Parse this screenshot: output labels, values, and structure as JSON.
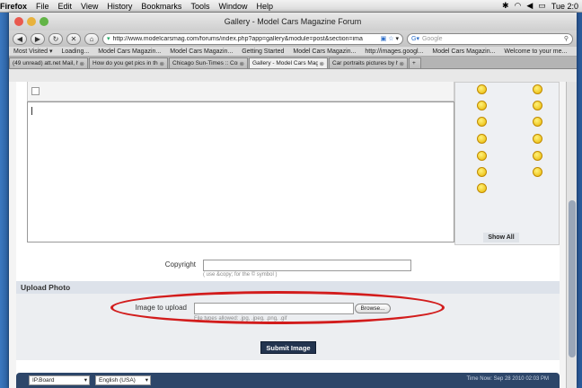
{
  "menubar": {
    "app": "Firefox",
    "items": [
      "File",
      "Edit",
      "View",
      "History",
      "Bookmarks",
      "Tools",
      "Window",
      "Help"
    ],
    "clock": "Tue 2:0"
  },
  "window": {
    "title": "Gallery - Model Cars Magazine Forum",
    "url": "http://www.modelcarsmag.com/forums/index.php?app=gallery&module=post&section=ima",
    "search_placeholder": "Google"
  },
  "bookmarks": [
    "Most Visited ▾",
    "Loading...",
    "Model Cars Magazin...",
    "Model Cars Magazin...",
    "Getting Started",
    "Model Cars Magazin...",
    "http://images.googl...",
    "Model Cars Magazin...",
    "Welcome to your me..."
  ],
  "tabs": [
    {
      "label": "(49 unread) att.net Mail, harr...",
      "active": false
    },
    {
      "label": "How do you get pics in the g...",
      "active": false
    },
    {
      "label": "Chicago Sun-Times :: Comme...",
      "active": false
    },
    {
      "label": "Gallery - Model Cars Magazi...",
      "active": true
    },
    {
      "label": "Car portraits pictures by harr...",
      "active": false
    }
  ],
  "editor": {
    "show_all": "Show All"
  },
  "form": {
    "copyright_label": "Copyright",
    "copyright_value": "",
    "copyright_hint": "( use &copy; for the © symbol )",
    "section_title": "Upload Photo",
    "image_label": "Image to upload",
    "image_value": "",
    "browse_label": "Browse...",
    "filetypes_hint": "File types allowed: .jpg, .jpeg, .png, .gif",
    "submit_label": "Submit Image"
  },
  "footer": {
    "skin_select": "IP.Board",
    "lang_select": "English (USA)",
    "time_now": "Time Now: Sep 28 2010 02:03 PM"
  },
  "colors": {
    "accent": "#23344f",
    "highlight_ring": "#d21c1c"
  }
}
